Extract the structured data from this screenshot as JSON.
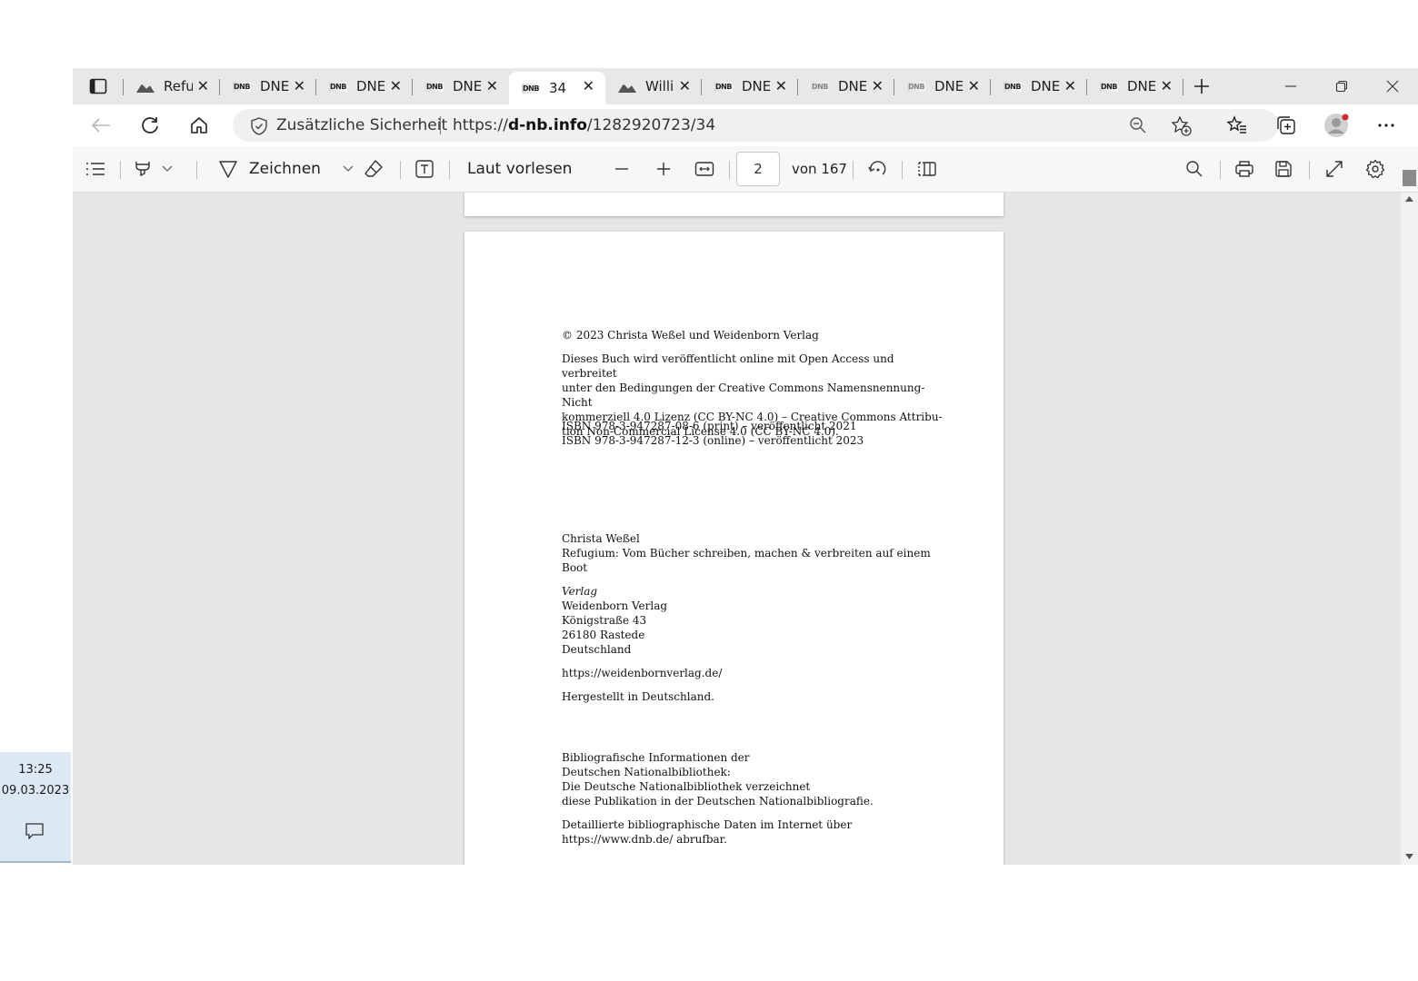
{
  "taskbar": {
    "time": "13:25",
    "date": "09.03.2023"
  },
  "tabs": [
    {
      "title": "Refu",
      "icon": "image-icon"
    },
    {
      "title": "DNE",
      "icon": "dnb-icon"
    },
    {
      "title": "DNE",
      "icon": "dnb-icon"
    },
    {
      "title": "DNE",
      "icon": "dnb-icon"
    },
    {
      "title": "34",
      "icon": "dnb-icon",
      "active": true
    },
    {
      "title": "Willi",
      "icon": "image-icon"
    },
    {
      "title": "DNE",
      "icon": "dnb-icon"
    },
    {
      "title": "DNE",
      "icon": "dnb-icon"
    },
    {
      "title": "DNE",
      "icon": "dnb-icon"
    },
    {
      "title": "DNE",
      "icon": "dnb-icon"
    },
    {
      "title": "DNE",
      "icon": "dnb-icon"
    }
  ],
  "favicon_text": "DNB",
  "close_glyph": "✕",
  "address": {
    "security_label": "Zusätzliche Sicherheit",
    "url_prefix": "https://",
    "url_domain": "d-nb.info",
    "url_path": "/1282920723/34"
  },
  "pdf_toolbar": {
    "draw_label": "Zeichnen",
    "read_aloud_label": "Laut vorlesen",
    "page_current": "2",
    "page_total_label": "von 167"
  },
  "document": {
    "copyright": "© 2023 Christa Weßel und Weidenborn Verlag",
    "license_lines": [
      "Dieses Buch wird veröffentlicht online mit Open Access und verbreitet",
      "unter den Bedingungen der Creative Commons Namensnennung-Nicht",
      "kommerziell 4.0 Lizenz (CC BY-NC 4.0) – Creative Commons Attribu-",
      "tion Non-Commercial License 4.0 (CC BY-NC 4.0)."
    ],
    "isbn_lines": [
      "ISBN 978-3-947287-08-6 (print) – veröffentlicht 2021",
      "ISBN 978-3-947287-12-3 (online) – veröffentlicht 2023"
    ],
    "author": "Christa Weßel",
    "title": "Refugium: Vom Bücher schreiben, machen & verbreiten auf einem Boot",
    "publisher_heading": "Verlag",
    "publisher_lines": [
      "Weidenborn Verlag",
      "Königstraße 43",
      "26180 Rastede",
      "Deutschland"
    ],
    "publisher_url": "https://weidenbornverlag.de/",
    "made_in": "Hergestellt in Deutschland.",
    "biblio_lines": [
      "Bibliografische Informationen der",
      "Deutschen Nationalbibliothek:",
      "Die Deutsche Nationalbibliothek verzeichnet",
      "diese Publikation in der Deutschen Nationalbibliografie."
    ],
    "detail_lines": [
      "Detaillierte bibliographische Daten im Internet über",
      "https://www.dnb.de/ abrufbar."
    ]
  }
}
